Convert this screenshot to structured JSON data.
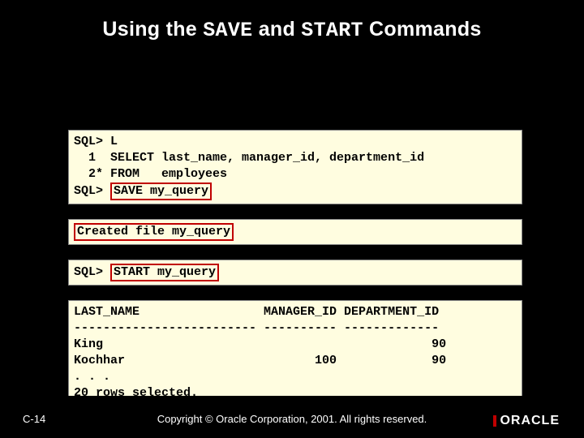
{
  "title": {
    "p1": "Using the ",
    "code1": "SAVE",
    "p2": " and ",
    "code2": "START",
    "p3": " Commands"
  },
  "box1": {
    "l1": "SQL> L",
    "l2": "  1  SELECT last_name, manager_id, department_id",
    "l3": "  2* FROM   employees",
    "l4a": "SQL> ",
    "l4b": "SAVE my_query"
  },
  "box2": {
    "l1": "Created file my_query"
  },
  "box3": {
    "l1a": "SQL> ",
    "l1b": "START my_query"
  },
  "box4": {
    "l1": "LAST_NAME                 MANAGER_ID DEPARTMENT_ID",
    "l2": "------------------------- ---------- -------------",
    "l3": "King                                             90",
    "l4": "Kochhar                          100             90",
    "l5": ". . .",
    "l6": "20 rows selected."
  },
  "footer": {
    "page": "C-14",
    "copyright": "Copyright © Oracle Corporation, 2001. All rights reserved.",
    "logo": "ORACLE"
  }
}
